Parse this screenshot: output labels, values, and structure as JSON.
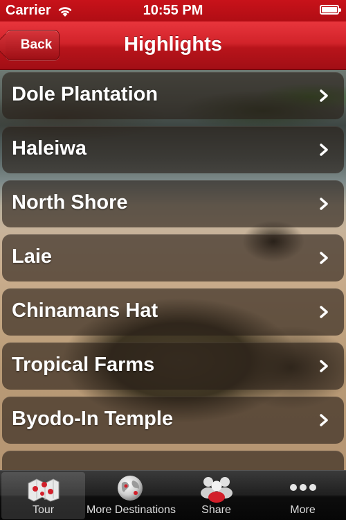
{
  "status_bar": {
    "carrier": "Carrier",
    "time": "10:55 PM"
  },
  "nav_bar": {
    "back_label": "Back",
    "title": "Highlights"
  },
  "list": {
    "items": [
      {
        "label": "Dole Plantation"
      },
      {
        "label": "Haleiwa"
      },
      {
        "label": "North Shore"
      },
      {
        "label": "Laie"
      },
      {
        "label": "Chinamans Hat"
      },
      {
        "label": "Tropical Farms"
      },
      {
        "label": "Byodo-In Temple"
      },
      {
        "label": ""
      }
    ]
  },
  "tab_bar": {
    "tabs": [
      {
        "label": "Tour",
        "icon": "map-icon",
        "selected": true
      },
      {
        "label": "More Destinations",
        "icon": "globe-icon",
        "selected": false
      },
      {
        "label": "Share",
        "icon": "people-icon",
        "selected": false
      },
      {
        "label": "More",
        "icon": "ellipsis-icon",
        "selected": false
      }
    ]
  },
  "colors": {
    "brand_red": "#c8121a",
    "tab_bar": "#1a1a1a"
  }
}
